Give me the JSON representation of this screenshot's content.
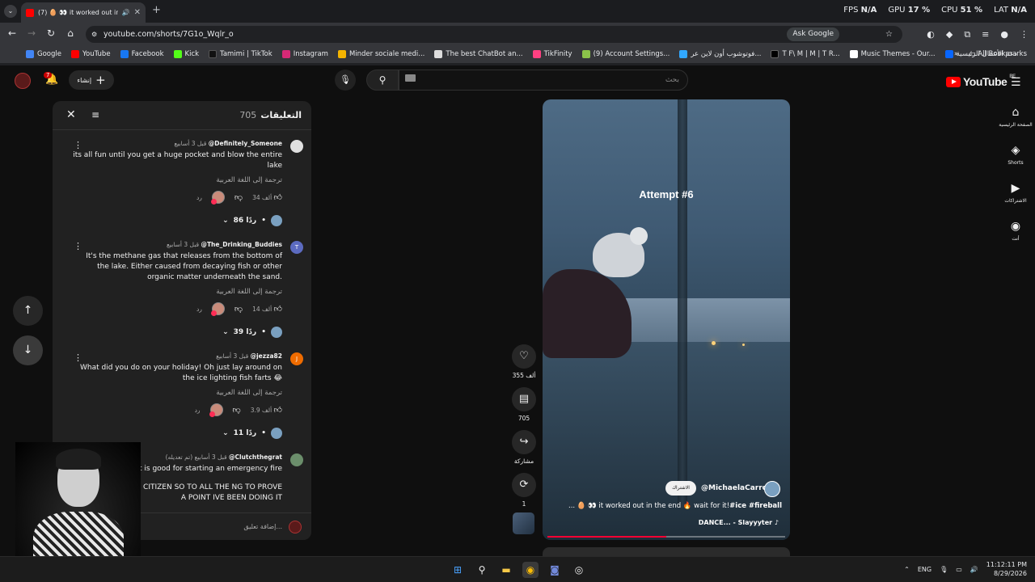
{
  "browser": {
    "tab_title": "(7) 🥚 👀 it worked out in t",
    "url": "youtube.com/shorts/7G1o_Wqlr_o",
    "ask_google": "Ask Google",
    "stats": {
      "fps_label": "FPS",
      "fps": "N/A",
      "gpu_label": "GPU",
      "gpu": "17 %",
      "cpu_label": "CPU",
      "cpu": "51 %",
      "lat_label": "LAT",
      "lat": "N/A"
    },
    "bookmarks": [
      "Google",
      "YouTube",
      "Facebook",
      "Kick",
      "Tamimi | TikTok",
      "Instagram",
      "Minder sociale medi...",
      "The best ChatBot an...",
      "TikFinity",
      "(9) Account Settings...",
      "فوتوشوب أون لاين عر...",
      "T F\\ M | M | T R...",
      "Music Themes - Our...",
      "دعم الأعمال الرئيسية"
    ],
    "all_bookmarks": "All Bookmarks"
  },
  "youtube": {
    "logo_text": "YouTube",
    "logo_region": "BE",
    "search_placeholder": "بحث",
    "create_label": "إنشاء",
    "notif_count": "7",
    "right_nav": [
      {
        "icon": "home-icon",
        "label": "الصفحة الرئيسية"
      },
      {
        "icon": "shorts-icon",
        "label": "Shorts"
      },
      {
        "icon": "subscriptions-icon",
        "label": "الاشتراكات"
      },
      {
        "icon": "you-icon",
        "label": "أنت"
      }
    ]
  },
  "short": {
    "overlay_title": "Attempt #6",
    "channel": "@MichaelaCarrot",
    "subscribe_label": "الاشتراك",
    "caption_text": "... 🥚 👀 it worked out in the end 🔥 wait for it!",
    "caption_tags": "#ice #fireball",
    "music": "DANCE... - Slayyyter ♪",
    "progress": 0.5,
    "actions": {
      "likes": "355 ألف",
      "comments": "705",
      "share": "مشاركة",
      "remix": "1"
    }
  },
  "comments": {
    "title": "التعليقات",
    "count": "705",
    "add_placeholder": "إضافة تعليق...",
    "translate_label": "ترجمة إلى اللغة العربية",
    "reply_label": "رد",
    "items": [
      {
        "author": "@Definitely_Someone",
        "time": "قبل 3 أسابيع",
        "text": "its all fun until you get a huge pocket and blow the entire lake",
        "likes": "34 ألف",
        "replies": "86 ردًا",
        "avatar_color": "#e0e0e0",
        "avatar_letter": ""
      },
      {
        "author": "@The_Drinking_Buddies",
        "time": "قبل 3 أسابيع",
        "text": "It's the methane gas that releases from the bottom of the lake. Either caused from decaying fish or other organic matter underneath the sand.",
        "likes": "14 ألف",
        "replies": "39 ردًا",
        "avatar_color": "#5c6bc0",
        "avatar_letter": "T"
      },
      {
        "author": "@jezza82",
        "time": "قبل 3 أسابيع",
        "text": "What did you do on your holiday! Oh just lay around on the ice lighting fish farts 😂",
        "likes": "3.9 ألف",
        "replies": "11 ردًا",
        "avatar_color": "#ef6c00",
        "avatar_letter": "J"
      },
      {
        "author": "@Clutchthegrat",
        "time": "قبل 3 أسابيع (تم تعديله)",
        "text": "That is good for starting an emergency fire",
        "extra": "SAKHAIA QUTIAN CITIZEN SO TO ALL THE NG TO PROVE A POINT IVE BEEN DOING IT",
        "avatar_color": "#6b8e6b",
        "avatar_letter": ""
      }
    ]
  },
  "taskbar": {
    "lang": "ENG",
    "time": "11:12:11 PM",
    "date": "8/29/2026"
  }
}
